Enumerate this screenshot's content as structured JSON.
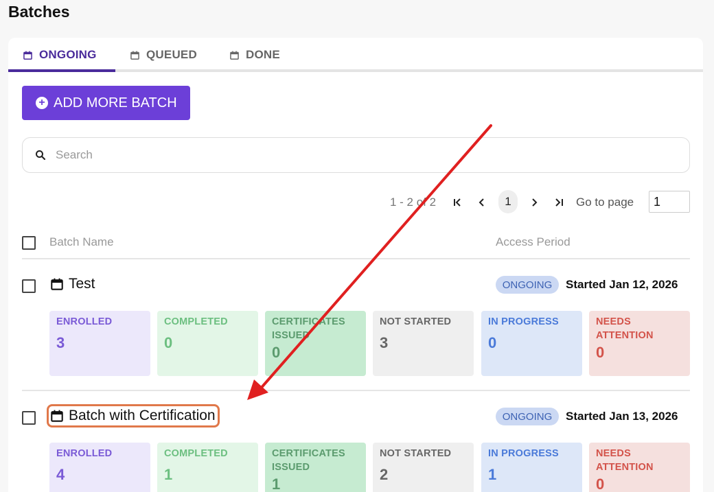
{
  "page": {
    "title": "Batches"
  },
  "tabs": [
    {
      "label": "ONGOING",
      "active": true,
      "icon": "calendar-icon"
    },
    {
      "label": "QUEUED",
      "active": false,
      "icon": "calendar-icon"
    },
    {
      "label": "DONE",
      "active": false,
      "icon": "calendar-icon"
    }
  ],
  "toolbar": {
    "add_label": "ADD MORE BATCH"
  },
  "search": {
    "placeholder": "Search"
  },
  "pagination": {
    "range": "1 - 2 of 2",
    "current_page": "1",
    "goto_label": "Go to page",
    "goto_value": "1"
  },
  "table": {
    "headers": {
      "name": "Batch Name",
      "access": "Access Period"
    },
    "rows": [
      {
        "name": "Test",
        "status": "ONGOING",
        "started": "Started Jan 12, 2026",
        "stats": [
          {
            "label": "ENROLLED",
            "value": "3"
          },
          {
            "label": "COMPLETED",
            "value": "0"
          },
          {
            "label": "CERTIFICATES ISSUED",
            "value": "0"
          },
          {
            "label": "NOT STARTED",
            "value": "3"
          },
          {
            "label": "IN PROGRESS",
            "value": "0"
          },
          {
            "label": "NEEDS ATTENTION",
            "value": "0"
          }
        ]
      },
      {
        "name": "Batch with Certification",
        "status": "ONGOING",
        "started": "Started Jan 13, 2026",
        "stats": [
          {
            "label": "ENROLLED",
            "value": "4"
          },
          {
            "label": "COMPLETED",
            "value": "1"
          },
          {
            "label": "CERTIFICATES ISSUED",
            "value": "1"
          },
          {
            "label": "NOT STARTED",
            "value": "2"
          },
          {
            "label": "IN PROGRESS",
            "value": "1"
          },
          {
            "label": "NEEDS ATTENTION",
            "value": "0"
          }
        ]
      }
    ]
  },
  "colors": {
    "accent": "#6c3fd8",
    "tab_active": "#4a2b9b",
    "annotation_arrow": "#e02020",
    "highlight_box": "#e0784a"
  }
}
